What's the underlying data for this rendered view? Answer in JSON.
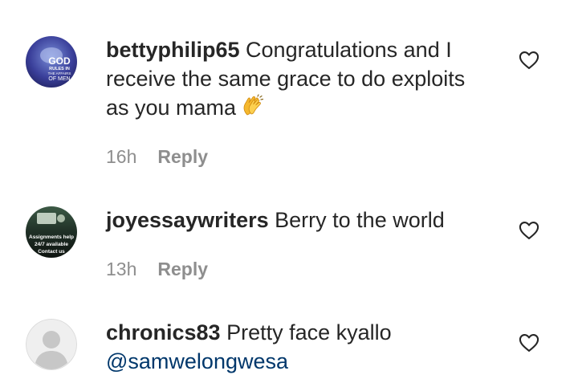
{
  "comments": [
    {
      "username": "bettyphilip65",
      "text": "Congratulations and I receive the same grace to do exploits as you mama",
      "emoji": "clapping-hands",
      "time": "16h",
      "reply_label": "Reply",
      "avatar_text": [
        "GOD",
        "RULES IN",
        "THE AFFAIRS",
        "OF MEN"
      ]
    },
    {
      "username": "joyessaywriters",
      "text": "Berry to the world",
      "time": "13h",
      "reply_label": "Reply",
      "avatar_text": [
        "Assignments help",
        "24/7 available",
        "Contact us"
      ]
    },
    {
      "username": "chronics83",
      "text": "Pretty face kyallo",
      "mention": "@samwelongwesa"
    }
  ],
  "icons": {
    "like": "heart-outline-icon",
    "avatar_placeholder": "default-avatar-icon"
  },
  "colors": {
    "text": "#262626",
    "meta": "#8e8e8e",
    "mention": "#00376b"
  }
}
